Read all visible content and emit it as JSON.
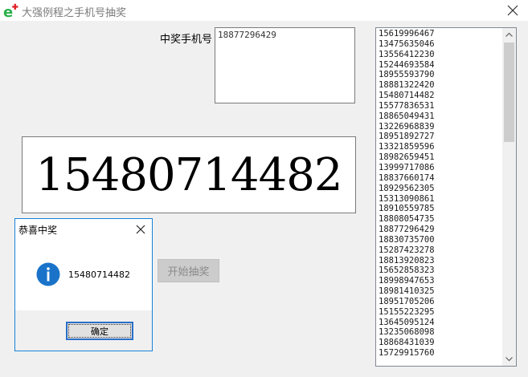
{
  "window": {
    "title": "大强例程之手机号抽奖"
  },
  "main": {
    "winner_label": "中奖手机号",
    "winner_box_value": "18877296429",
    "big_number": "15480714482",
    "start_button_label": "开始抽奖"
  },
  "phone_list": [
    "15619996467",
    "13475635046",
    "13556412230",
    "15244693584",
    "18955593790",
    "18881322420",
    "15480714482",
    "15577836531",
    "18865049431",
    "13226968839",
    "18951892727",
    "13321859596",
    "18982659451",
    "13999717086",
    "18837660174",
    "18929562305",
    "15313090861",
    "18910559785",
    "18808054735",
    "18877296429",
    "18830735700",
    "15287423278",
    "18813920823",
    "15652858323",
    "18998947653",
    "18981410325",
    "18951705206",
    "15155223295",
    "13645095124",
    "13235068098",
    "18868431039",
    "15729915760"
  ],
  "dialog": {
    "title": "恭喜中奖",
    "message": "15480714482",
    "ok_label": "确定"
  },
  "icons": {
    "app": "ie-like-app-icon",
    "close": "close-icon",
    "info": "info-icon",
    "scroll_up": "chevron-up-icon",
    "scroll_down": "chevron-down-icon"
  },
  "colors": {
    "info_icon": "#1a73c9",
    "dialog_border": "#1883d7",
    "app_icon_green": "#2bb04a",
    "app_icon_red": "#e0242a"
  }
}
